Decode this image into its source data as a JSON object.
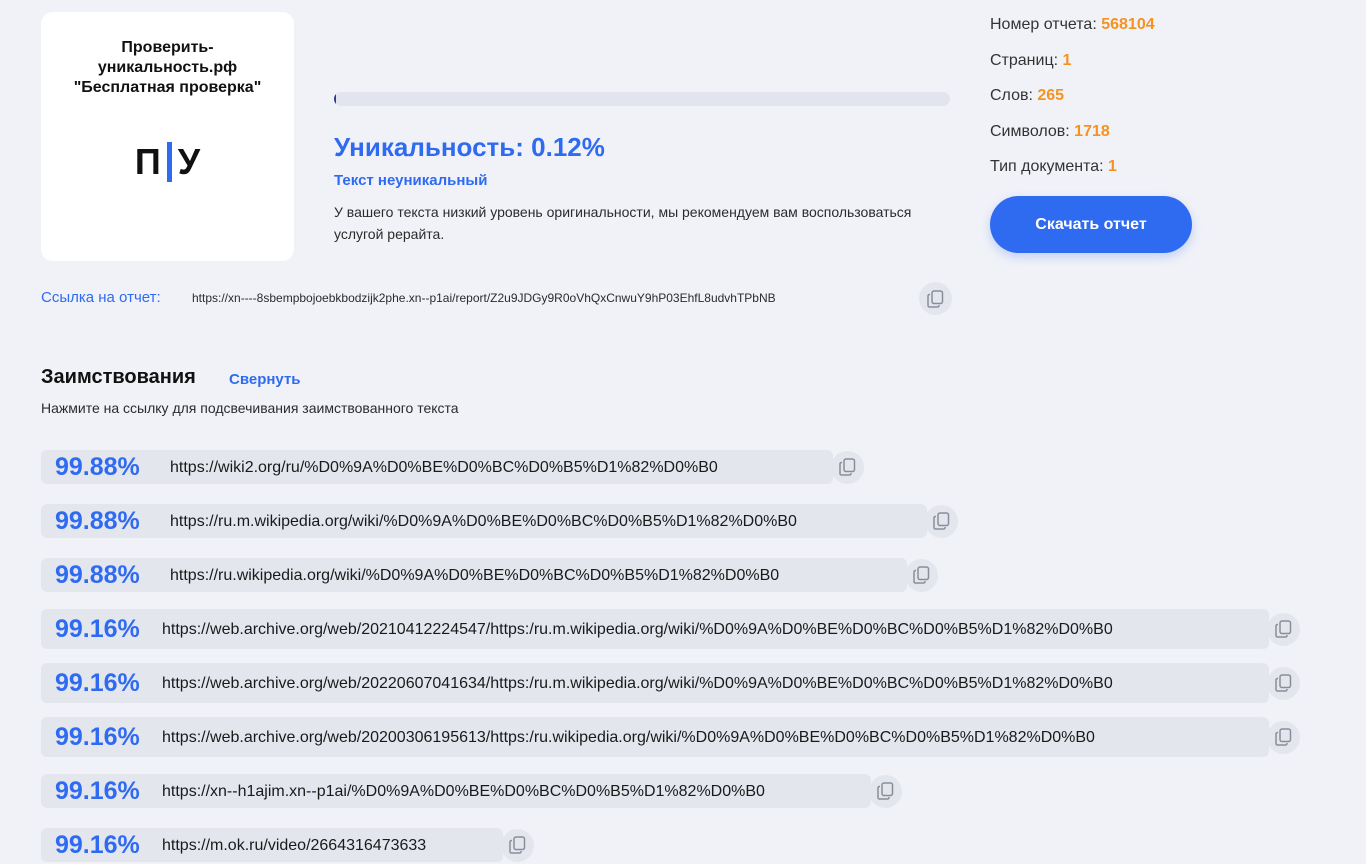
{
  "logo": {
    "title_lines": [
      "Проверить-",
      "уникальность.рф",
      "\"Бесплатная проверка\""
    ],
    "mark_left": "П",
    "mark_right": "У",
    "accent_color": "#2f6bf0"
  },
  "result": {
    "progress_fraction": 0.0012,
    "title": "Уникальность: 0.12%",
    "status": "Текст неуникальный",
    "description": "У вашего текста низкий уровень оригинальности, мы рекомендуем вам воспользоваться услугой рерайта."
  },
  "stats": {
    "report_number_label": "Номер отчета:",
    "report_number": "568104",
    "pages_label": "Страниц:",
    "pages": "1",
    "words_label": "Слов:",
    "words": "265",
    "chars_label": "Символов:",
    "chars": "1718",
    "doc_type_label": "Тип документа:",
    "doc_type": "1",
    "value_color": "#f5931e"
  },
  "download_button": "Скачать отчет",
  "report_link": {
    "label": "Ссылка на отчет:",
    "url": "https://xn----8sbempbojoebkbodzijk2phe.xn--p1ai/report/Z2u9JDGy9R0oVhQxCnwuY9hP03EhfL8udvhTPbNB",
    "copy_icon": "copy-icon"
  },
  "borrowings": {
    "title": "Заимствования",
    "collapse_label": "Свернуть",
    "hint": "Нажмите на ссылку для подсвечивания заимствованного текста",
    "items": [
      {
        "percent": "99.88%",
        "url": "https://wiki2.org/ru/%D0%9A%D0%BE%D0%BC%D0%B5%D1%82%D0%B0"
      },
      {
        "percent": "99.88%",
        "url": "https://ru.m.wikipedia.org/wiki/%D0%9A%D0%BE%D0%BC%D0%B5%D1%82%D0%B0"
      },
      {
        "percent": "99.88%",
        "url": "https://ru.wikipedia.org/wiki/%D0%9A%D0%BE%D0%BC%D0%B5%D1%82%D0%B0"
      },
      {
        "percent": "99.16%",
        "url": "https://web.archive.org/web/20210412224547/https:/ru.m.wikipedia.org/wiki/%D0%9A%D0%BE%D0%BC%D0%B5%D1%82%D0%B0"
      },
      {
        "percent": "99.16%",
        "url": "https://web.archive.org/web/20220607041634/https:/ru.m.wikipedia.org/wiki/%D0%9A%D0%BE%D0%BC%D0%B5%D1%82%D0%B0"
      },
      {
        "percent": "99.16%",
        "url": "https://web.archive.org/web/20200306195613/https:/ru.wikipedia.org/wiki/%D0%9A%D0%BE%D0%BC%D0%B5%D1%82%D0%B0"
      },
      {
        "percent": "99.16%",
        "url": "https://xn--h1ajim.xn--p1ai/%D0%9A%D0%BE%D0%BC%D0%B5%D1%82%D0%B0"
      },
      {
        "percent": "99.16%",
        "url": "https://m.ok.ru/video/2664316473633"
      }
    ]
  }
}
